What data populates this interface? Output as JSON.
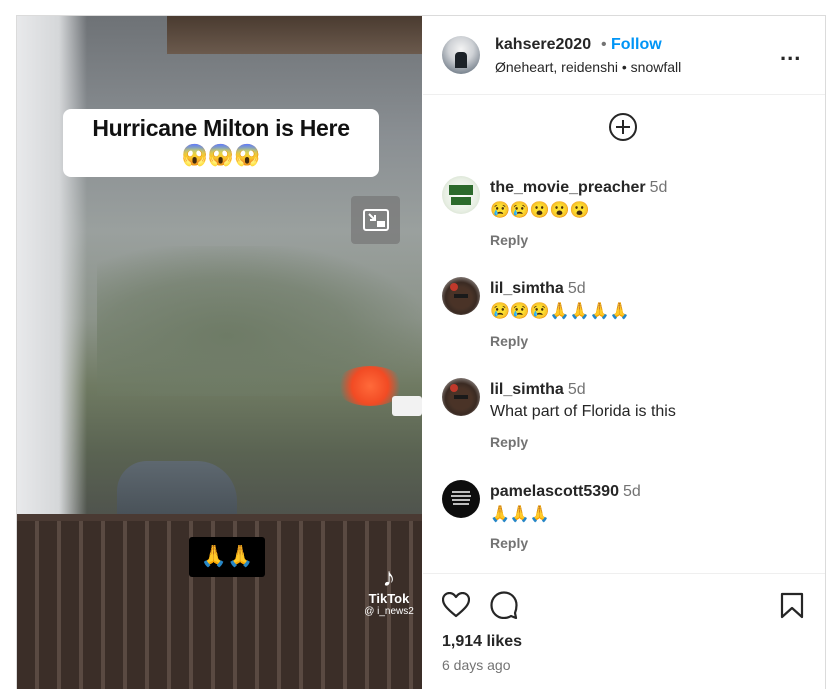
{
  "post": {
    "username": "kahsere2020",
    "separator": "•",
    "follow_label": "Follow",
    "collaborators": "Øneheart, reidenshi",
    "audio_sep": "•",
    "audio": "snowfall",
    "more_label": "..."
  },
  "media": {
    "caption_title": "Hurricane Milton is Here",
    "caption_emoji": "😱😱😱",
    "overlay_emoji": "🙏🙏",
    "tiktok_logo": "♪",
    "tiktok_name": "TikTok",
    "tiktok_handle": "@ i_news2"
  },
  "comments": [
    {
      "user": "the_movie_preacher",
      "time": "5d",
      "text": "😢😢😮😮😮",
      "reply": "Reply"
    },
    {
      "user": "lil_simtha",
      "time": "5d",
      "text": "😢😢😢🙏🙏🙏🙏",
      "reply": "Reply"
    },
    {
      "user": "lil_simtha",
      "time": "5d",
      "text": "What part of Florida is this",
      "reply": "Reply"
    },
    {
      "user": "pamelascott5390",
      "time": "5d",
      "text": "🙏🙏🙏",
      "reply": "Reply"
    }
  ],
  "footer": {
    "likes": "1,914 likes",
    "time_ago": "6 days ago"
  },
  "colors": {
    "link_blue": "#0095f6",
    "secondary_text": "#737373",
    "border": "#dbdbdb"
  },
  "icons": [
    "heart-icon",
    "comment-icon",
    "bookmark-icon",
    "add-circle-icon",
    "pip-icon",
    "more-icon"
  ]
}
